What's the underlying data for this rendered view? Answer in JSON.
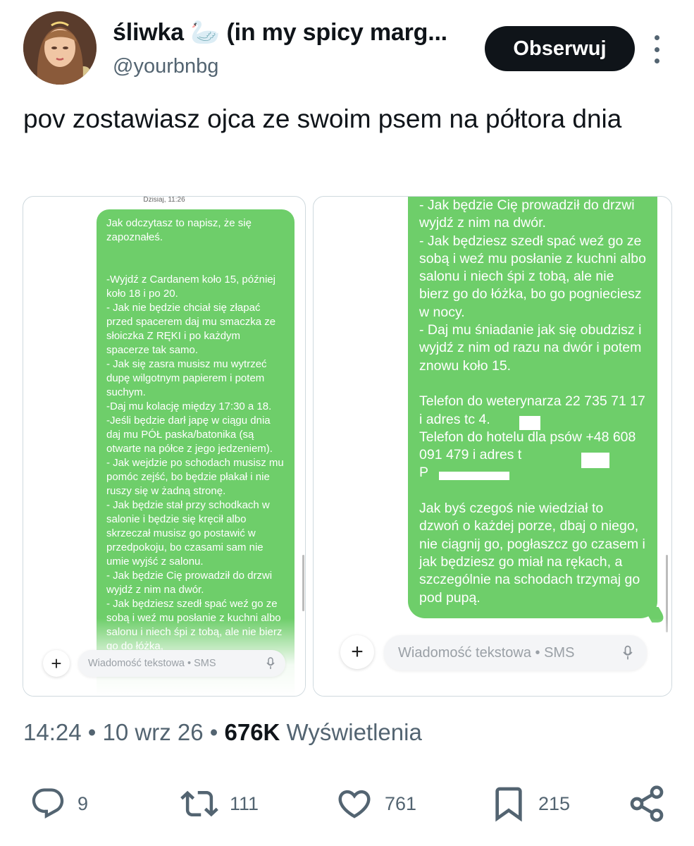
{
  "author": {
    "display_name": "śliwka 🦢 (in my spicy marg...",
    "handle": "@yourbnbg",
    "follow_label": "Obserwuj"
  },
  "tweet": {
    "text": "pov zostawiasz ojca ze swoim psem na półtora dnia"
  },
  "media": {
    "left": {
      "date_label": "Dzisiaj, 11:26",
      "message": "Jak odczytasz to napisz, że się zapoznałeś.\n\n\n-Wyjdź z Cardanem koło 15, później koło 18 i po 20.\n- Jak nie będzie chciał się złapać przed spacerem daj mu smaczka ze słoiczka Z RĘKI i po każdym spacerze tak samo.\n- Jak się zasra musisz mu wytrzeć dupę wilgotnym papierem i potem suchym.\n-Daj mu kolację między 17:30 a 18.\n-Jeśli będzie darł japę w ciągu dnia daj mu PÓŁ paska/batonika (są otwarte na półce z jego jedzeniem).\n- Jak wejdzie po schodach musisz mu pomóc zejść, bo będzie płakał i nie ruszy się w żadną stronę.\n- Jak będzie stał przy schodkach w salonie i będzie się kręcił albo skrzeczał musisz go postawić w przedpokoju, bo czasami sam nie umie wyjść z salonu.\n- Jak będzie Cię prowadził do drzwi wyjdź z nim na dwór.\n- Jak będziesz szedł spać weź go ze sobą i weź mu posłanie z kuchni albo salonu i niech śpi z tobą, ale nie bierz go do łóżka,",
      "input_placeholder": "Wiadomość tekstowa • SMS"
    },
    "right": {
      "message": "- Jak będzie Cię prowadził do drzwi wyjdź z nim na dwór.\n- Jak będziesz szedł spać weź go ze sobą i weź mu posłanie z kuchni albo salonu i niech śpi z tobą, ale nie bierz go do łóżka, bo go pognieciesz w nocy.\n- Daj mu śniadanie jak się obudzisz i wyjdź z nim od razu na dwór i potem znowu koło 15.\n\nTelefon do weterynarza 22 735 71 17 i adres tc           4.\nTelefon do hotelu dla psów +48 608 091 479 i adres t\nP\n\nJak byś czegoś nie wiedział to dzwoń o każdej porze, dbaj o niego, nie ciągnij go, pogłaszcz go czasem i jak będziesz go miał na rękach, a szczególnie na schodach trzymaj go pod pupą.",
      "input_placeholder": "Wiadomość tekstowa • SMS"
    }
  },
  "meta": {
    "time": "14:24",
    "date": "10 wrz 26",
    "separator": "•",
    "views_count": "676K",
    "views_label": "Wyświetlenia"
  },
  "actions": {
    "replies": "9",
    "reposts": "111",
    "likes": "761",
    "bookmarks": "215"
  },
  "icons": [
    "reply-icon",
    "repost-icon",
    "like-icon",
    "bookmark-icon",
    "share-icon",
    "more-icon",
    "mic-icon",
    "plus-icon"
  ],
  "colors": {
    "sms_bubble": "#6ece6a",
    "follow_button": "#0f1419",
    "secondary_text": "#536471"
  }
}
